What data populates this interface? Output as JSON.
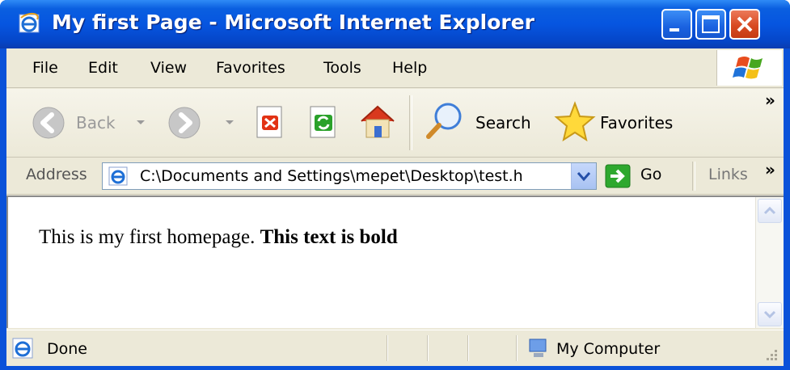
{
  "window": {
    "title": "My first Page - Microsoft Internet Explorer"
  },
  "menu": {
    "items": [
      "File",
      "Edit",
      "View",
      "Favorites",
      "Tools",
      "Help"
    ]
  },
  "toolbar": {
    "back_label": "Back",
    "search_label": "Search",
    "favorites_label": "Favorites",
    "chevron": "»"
  },
  "address": {
    "label": "Address",
    "value": "C:\\Documents and Settings\\mepet\\Desktop\\test.h",
    "go_label": "Go",
    "links_label": "Links",
    "chevron": "»"
  },
  "page": {
    "normal_text": "This is my first homepage.",
    "bold_text": "This text is bold"
  },
  "status": {
    "text": "Done",
    "zone": "My Computer"
  },
  "colors": {
    "titlebar": "#0655e0",
    "chrome": "#ece9d8",
    "close_button": "#d84a22"
  }
}
